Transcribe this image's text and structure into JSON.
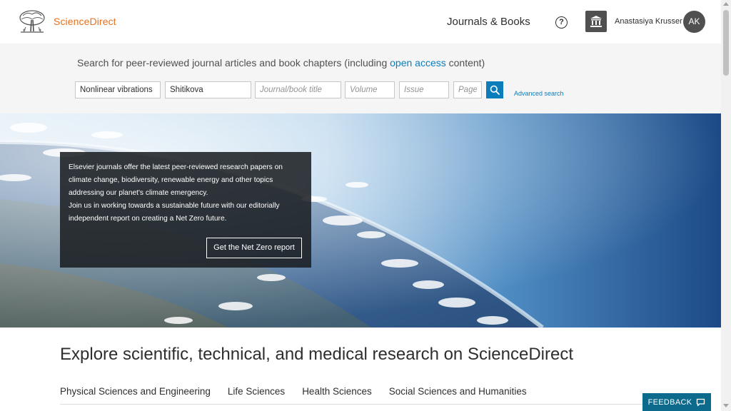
{
  "header": {
    "brand": "ScienceDirect",
    "nav_journals": "Journals & Books",
    "help_symbol": "?",
    "user_name": "Anastasiya Krusser",
    "user_initials": "AK"
  },
  "search": {
    "caption_before": "Search for peer-reviewed journal articles and book chapters (including ",
    "caption_link": "open access",
    "caption_after": " content)",
    "keywords_value": "Nonlinear vibrations",
    "author_value": "Shitikova",
    "journal_placeholder": "Journal/book title",
    "volume_placeholder": "Volume",
    "issue_placeholder": "Issue",
    "pages_placeholder": "Pages",
    "advanced_label": "Advanced search"
  },
  "hero": {
    "line1": "Elsevier journals offer the latest peer-reviewed research papers on",
    "line2": "climate change, biodiversity, renewable energy and other topics",
    "line3": "addressing our planet's climate emergency.",
    "line4": "Join us in working towards a sustainable future with our editorially",
    "line5": "independent report on creating a Net Zero future.",
    "cta_label": "Get the Net Zero report"
  },
  "explore": {
    "title": "Explore scientific, technical, and medical research on ScienceDirect",
    "tabs": [
      "Physical Sciences and Engineering",
      "Life Sciences",
      "Health Sciences",
      "Social Sciences and Humanities"
    ]
  },
  "feedback": {
    "label": "FEEDBACK"
  },
  "colors": {
    "brand_orange": "#e9711c",
    "link_blue": "#0c7dbb",
    "feedback_teal": "#0c6a8c"
  }
}
